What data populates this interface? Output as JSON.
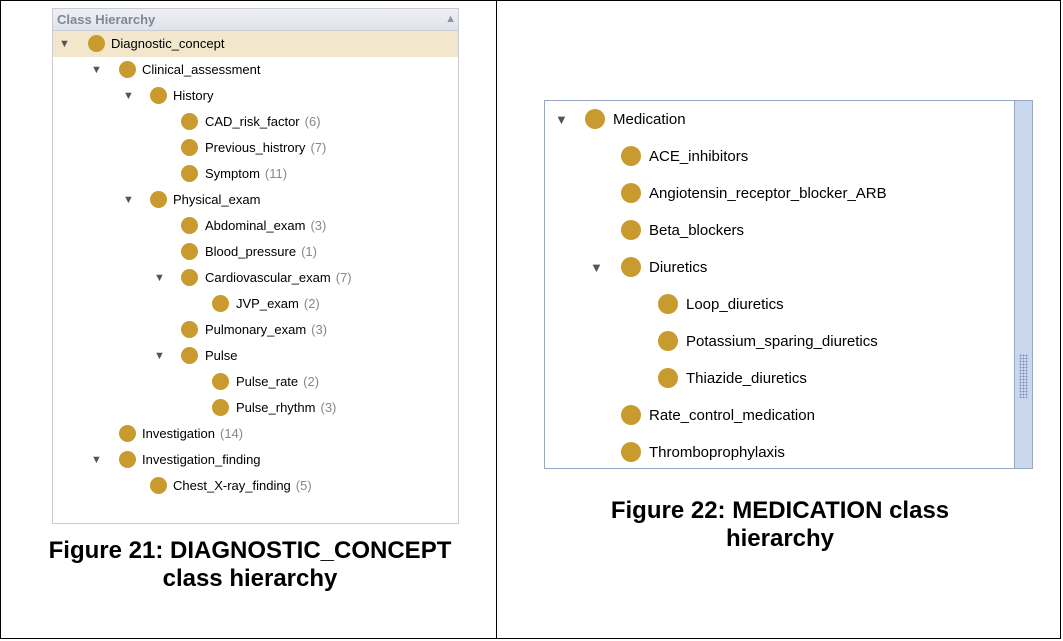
{
  "left_panel": {
    "header": "Class Hierarchy",
    "rows": [
      {
        "label": "Diagnostic_concept",
        "count": ""
      },
      {
        "label": "Clinical_assessment",
        "count": ""
      },
      {
        "label": "History",
        "count": ""
      },
      {
        "label": "CAD_risk_factor",
        "count": "(6)"
      },
      {
        "label": "Previous_histrory",
        "count": "(7)"
      },
      {
        "label": "Symptom",
        "count": "(11)"
      },
      {
        "label": "Physical_exam",
        "count": ""
      },
      {
        "label": "Abdominal_exam",
        "count": "(3)"
      },
      {
        "label": "Blood_pressure",
        "count": "(1)"
      },
      {
        "label": "Cardiovascular_exam",
        "count": "(7)"
      },
      {
        "label": "JVP_exam",
        "count": "(2)"
      },
      {
        "label": "Pulmonary_exam",
        "count": "(3)"
      },
      {
        "label": "Pulse",
        "count": ""
      },
      {
        "label": "Pulse_rate",
        "count": "(2)"
      },
      {
        "label": "Pulse_rhythm",
        "count": "(3)"
      },
      {
        "label": "Investigation",
        "count": "(14)"
      },
      {
        "label": "Investigation_finding",
        "count": ""
      },
      {
        "label": "Chest_X-ray_finding",
        "count": "(5)"
      }
    ]
  },
  "right_panel": {
    "rows": [
      {
        "label": "Medication"
      },
      {
        "label": "ACE_inhibitors"
      },
      {
        "label": "Angiotensin_receptor_blocker_ARB"
      },
      {
        "label": "Beta_blockers"
      },
      {
        "label": "Diuretics"
      },
      {
        "label": "Loop_diuretics"
      },
      {
        "label": "Potassium_sparing_diuretics"
      },
      {
        "label": "Thiazide_diuretics"
      },
      {
        "label": "Rate_control_medication"
      },
      {
        "label": "Thromboprophylaxis"
      }
    ]
  },
  "captions": {
    "left": "Figure 21: DIAGNOSTIC_CONCEPT class hierarchy",
    "right": "Figure 22: MEDICATION class hierarchy"
  },
  "colors": {
    "class_dot": "#c99a2e",
    "selected_row": "#f2e7cd",
    "scrollbar": "#c9d8ee"
  }
}
